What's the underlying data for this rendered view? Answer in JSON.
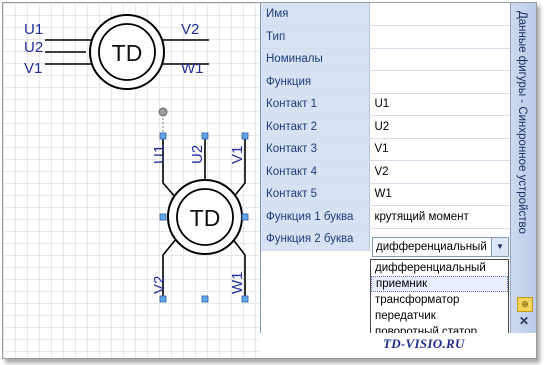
{
  "shape_a": {
    "center_label": "TD",
    "pins": [
      "U1",
      "U2",
      "V1",
      "V2",
      "W1"
    ]
  },
  "shape_b": {
    "center_label": "TD",
    "pins": [
      "U1",
      "U2",
      "V1",
      "V2",
      "W1"
    ]
  },
  "panel": {
    "title": "Данные фигуры - Синхронное устройство",
    "rows": [
      {
        "name": "Имя",
        "value": ""
      },
      {
        "name": "Тип",
        "value": ""
      },
      {
        "name": "Номиналы",
        "value": ""
      },
      {
        "name": "Функция",
        "value": ""
      },
      {
        "name": "Контакт 1",
        "value": "U1"
      },
      {
        "name": "Контакт 2",
        "value": "U2"
      },
      {
        "name": "Контакт 3",
        "value": "V1"
      },
      {
        "name": "Контакт 4",
        "value": "V2"
      },
      {
        "name": "Контакт 5",
        "value": "W1"
      },
      {
        "name": "Функция 1 буква",
        "value": "крутящий момент"
      },
      {
        "name": "Функция 2 буква",
        "value": ""
      }
    ],
    "dropdown": {
      "selected": "дифференциальный",
      "options": [
        "дифференциальный",
        "приемник",
        "трансформатор",
        "передатчик",
        "поворотный статор"
      ],
      "highlighted_index": 1
    },
    "pin_icon": "pin-icon",
    "close_icon": "close-icon"
  },
  "watermark": "TD-VISIO.RU",
  "colors": {
    "pin_label": "#1f2f9a",
    "property_name_bg": "#d6e1f2",
    "selection_handle": "#4f8fd8"
  }
}
